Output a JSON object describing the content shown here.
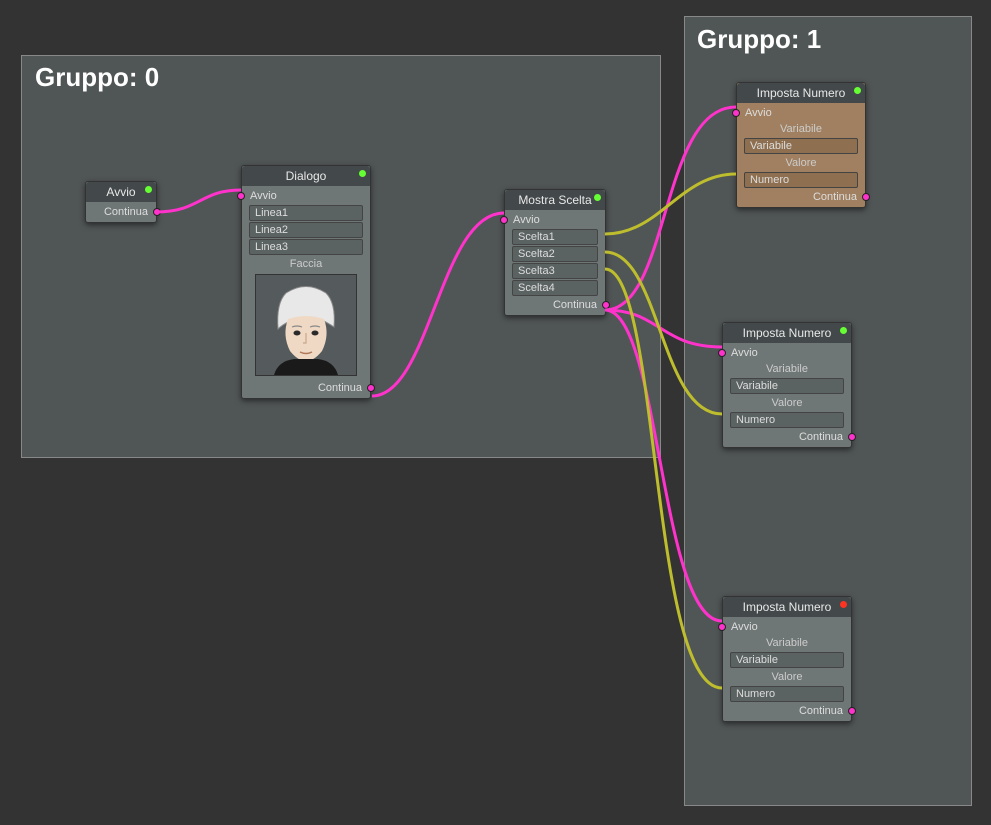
{
  "groups": {
    "g0": {
      "title": "Gruppo: 0"
    },
    "g1": {
      "title": "Gruppo: 1"
    }
  },
  "nodes": {
    "avvio": {
      "title": "Avvio",
      "continua": "Continua"
    },
    "dialogo": {
      "title": "Dialogo",
      "avvio": "Avvio",
      "linea1": "Linea1",
      "linea2": "Linea2",
      "linea3": "Linea3",
      "faccia": "Faccia",
      "continua": "Continua"
    },
    "mostra": {
      "title": "Mostra Scelta",
      "avvio": "Avvio",
      "scelta1": "Scelta1",
      "scelta2": "Scelta2",
      "scelta3": "Scelta3",
      "scelta4": "Scelta4",
      "continua": "Continua"
    },
    "imposta1": {
      "title": "Imposta Numero",
      "avvio": "Avvio",
      "variabile_lbl": "Variabile",
      "variabile_val": "Variabile",
      "valore_lbl": "Valore",
      "numero_val": "Numero",
      "continua": "Continua"
    },
    "imposta2": {
      "title": "Imposta Numero",
      "avvio": "Avvio",
      "variabile_lbl": "Variabile",
      "variabile_val": "Variabile",
      "valore_lbl": "Valore",
      "numero_val": "Numero",
      "continua": "Continua"
    },
    "imposta3": {
      "title": "Imposta Numero",
      "avvio": "Avvio",
      "variabile_lbl": "Variabile",
      "variabile_val": "Variabile",
      "valore_lbl": "Valore",
      "numero_val": "Numero",
      "continua": "Continua"
    }
  }
}
